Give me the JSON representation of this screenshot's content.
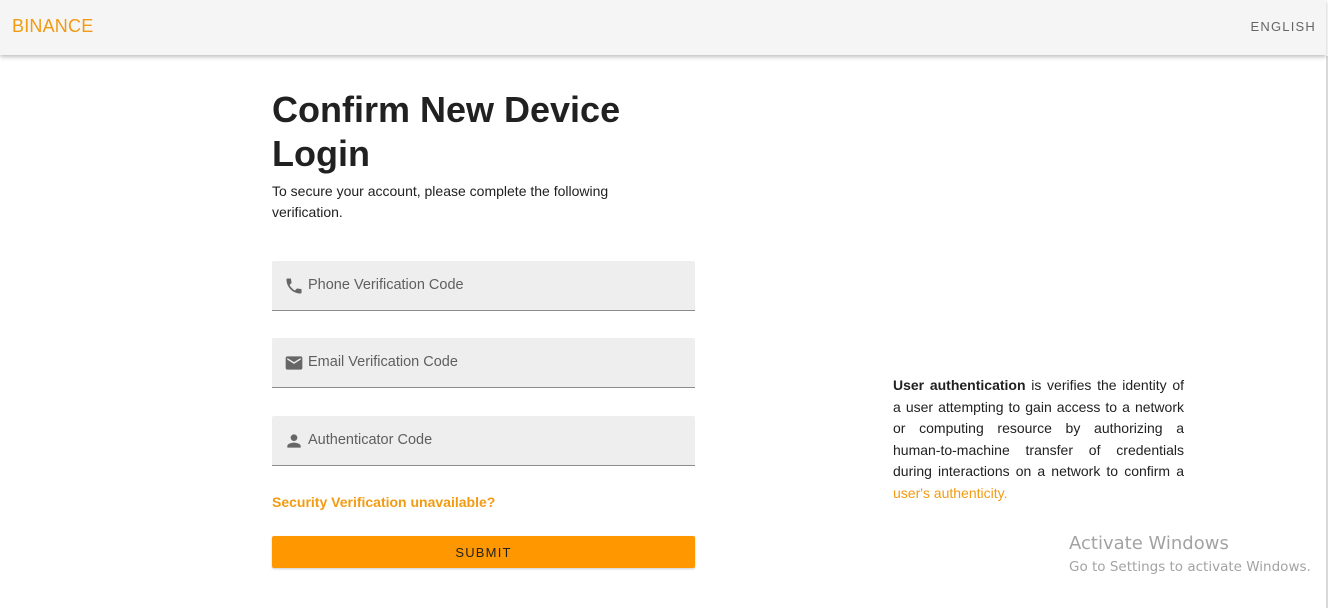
{
  "header": {
    "brand": "BINANCE",
    "language": "ENGLISH"
  },
  "main": {
    "title": "Confirm New Device Login",
    "subtitle": "To secure your account, please complete the following verification.",
    "fields": [
      {
        "placeholder": "Phone Verification Code",
        "icon": "phone-icon",
        "value": ""
      },
      {
        "placeholder": "Email Verification Code",
        "icon": "email-icon",
        "value": ""
      },
      {
        "placeholder": "Authenticator Code",
        "icon": "person-icon",
        "value": ""
      }
    ],
    "unavailable_link": "Security Verification unavailable?",
    "submit_label": "SUBMIT"
  },
  "info": {
    "bold_term": "User authentication",
    "body": " is verifies the identity of a user attempting to gain access to a network or computing resource by authorizing a human-to-machine transfer of credentials during interactions on a network to confirm a ",
    "link": "user's authenticity."
  },
  "watermark": {
    "title": "Activate Windows",
    "subtitle": "Go to Settings to activate Windows."
  },
  "colors": {
    "accent": "#f29b12",
    "button": "#ff9800",
    "field_bg": "#eeeeee",
    "header_bg": "#f5f5f5"
  }
}
